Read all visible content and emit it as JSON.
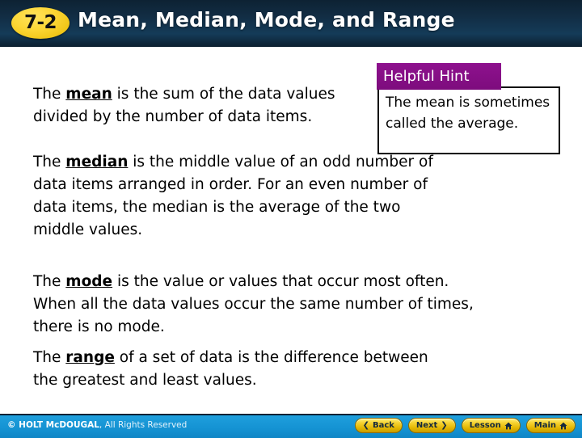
{
  "header": {
    "lesson_badge": "7-2",
    "title": "Mean, Median, Mode, and Range"
  },
  "content": {
    "paragraphs": [
      {
        "id": "mean",
        "prefix": "The ",
        "term": "mean",
        "suffix": " is the sum of the data values divided by the number of data items."
      },
      {
        "id": "median",
        "prefix": "The ",
        "term": "median",
        "suffix": " is the middle value of an odd number of data items arranged in order. For an even number of data items, the median is the average of the two middle values."
      },
      {
        "id": "mode",
        "prefix": "The ",
        "term": "mode",
        "suffix": " is the value or values that occur most often. When all the data values occur the same number of times, there is no mode."
      },
      {
        "id": "range",
        "prefix": "The ",
        "term": "range",
        "suffix": " of a set of data is the difference between the greatest and least values."
      }
    ]
  },
  "hint": {
    "header_label": "Helpful Hint",
    "body_text": "The mean is sometimes called the average.",
    "header_color": "#8b0f8b"
  },
  "footer": {
    "copyright_bold": "© HOLT McDOUGAL",
    "copyright_light": ", All Rights Reserved",
    "background_color": "#1593d3",
    "buttons": [
      {
        "label": "Back",
        "icon": "chevron-left-icon",
        "glyph": "❮",
        "icon_side": "left"
      },
      {
        "label": "Next",
        "icon": "chevron-right-icon",
        "glyph": "❯",
        "icon_side": "right"
      },
      {
        "label": "Lesson",
        "icon": "home-icon",
        "glyph": "home",
        "icon_side": "right"
      },
      {
        "label": "Main",
        "icon": "home-icon",
        "glyph": "home",
        "icon_side": "right"
      }
    ]
  }
}
